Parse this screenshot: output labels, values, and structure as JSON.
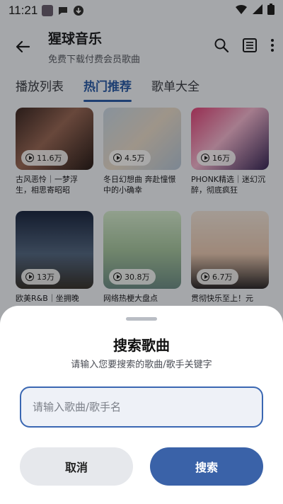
{
  "status": {
    "time": "11:21"
  },
  "app": {
    "title": "猩球音乐",
    "subtitle": "免费下载付费会员歌曲"
  },
  "tabs": [
    {
      "label": "播放列表",
      "active": false
    },
    {
      "label": "热门推荐",
      "active": true
    },
    {
      "label": "歌单大全",
      "active": false
    }
  ],
  "cards": [
    {
      "plays": "11.6万",
      "title": "古风恶怜｜一梦浮生，相思寄昭昭"
    },
    {
      "plays": "4.5万",
      "title": "冬日幻想曲 奔赴憧憬中的小确幸"
    },
    {
      "plays": "16万",
      "title": "PHONK精选｜迷幻沉醉，彻底疯狂"
    },
    {
      "plays": "13万",
      "title": "欧美R&B｜坐拥晚"
    },
    {
      "plays": "30.8万",
      "title": "网络热梗大盘点"
    },
    {
      "plays": "6.7万",
      "title": "贯彻快乐至上！元"
    }
  ],
  "dialog": {
    "title": "搜索歌曲",
    "subtitle": "请输入您要搜索的歌曲/歌手关键字",
    "input_placeholder": "请输入歌曲/歌手名",
    "input_value": "",
    "cancel_label": "取消",
    "search_label": "搜索"
  },
  "colors": {
    "accent": "#3a62a8",
    "tab_active": "#2d5ea8",
    "scrim": "rgba(0,0,0,0.32)"
  },
  "icons": [
    "back-arrow-icon",
    "search-icon",
    "list-icon",
    "more-vert-icon",
    "play-icon",
    "wifi-icon",
    "signal-icon",
    "battery-icon"
  ]
}
